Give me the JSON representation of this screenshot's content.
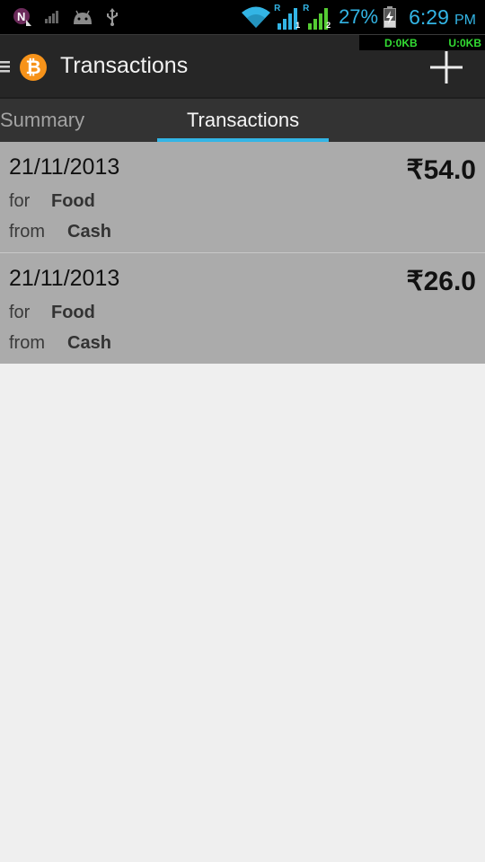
{
  "status_bar": {
    "left_icons": [
      "notification-n-icon",
      "signal-bars-icon",
      "android-icon",
      "usb-icon"
    ],
    "roaming_1": "R",
    "roaming_2": "R",
    "sim_1": "1",
    "sim_2": "2",
    "battery_percent": "27%",
    "time": "6:29",
    "ampm": "PM",
    "accent_color": "#33b5e5"
  },
  "data_monitor": {
    "download": "D:0KB",
    "upload": "U:0KB"
  },
  "action_bar": {
    "title": "Transactions",
    "logo_glyph": "₿",
    "add_glyph": "+"
  },
  "tabs": [
    {
      "label": "Summary",
      "selected": false
    },
    {
      "label": "Transactions",
      "selected": true
    }
  ],
  "transactions": [
    {
      "date": "21/11/2013",
      "amount": "₹54.0",
      "for_label": "for",
      "category": "Food",
      "from_label": "from",
      "account": "Cash"
    },
    {
      "date": "21/11/2013",
      "amount": "₹26.0",
      "for_label": "for",
      "category": "Food",
      "from_label": "from",
      "account": "Cash"
    }
  ],
  "colors": {
    "row_background": "#ababab",
    "page_background": "#efefef",
    "tab_indicator": "#33b5e5",
    "logo_orange": "#f7931a"
  }
}
